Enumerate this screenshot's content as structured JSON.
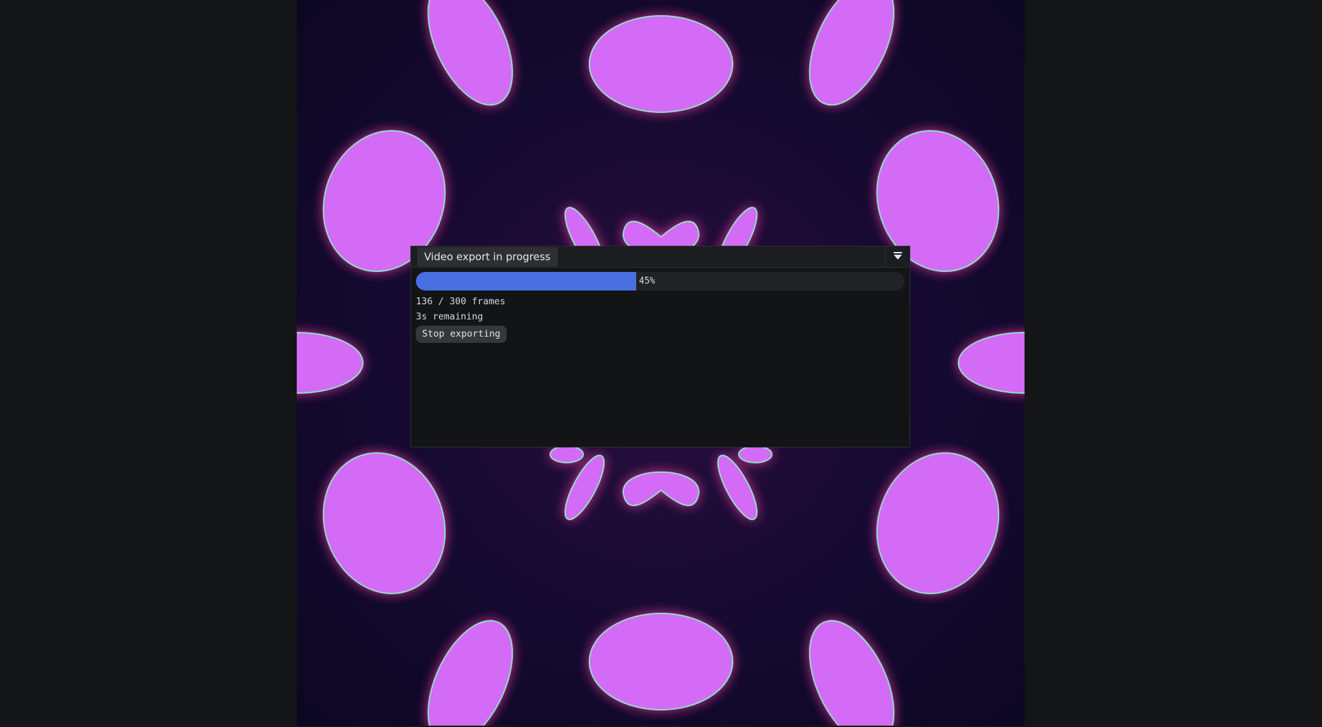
{
  "export_panel": {
    "title": "Video export in progress",
    "menu_icon": "collapse-menu-icon",
    "progress_fraction": 0.45,
    "progress_label": "45%",
    "frames_text": "136 / 300 frames",
    "remaining_text": "3s remaining",
    "stop_button_label": "Stop exporting"
  },
  "colors": {
    "background": "#141516",
    "shader_background": "#0f0826",
    "shader_blob": "#d36bf7",
    "shader_glow": "#ff3fb0",
    "shader_outline": "#8fe0c8",
    "progress_fill": "#4a6fe0"
  }
}
